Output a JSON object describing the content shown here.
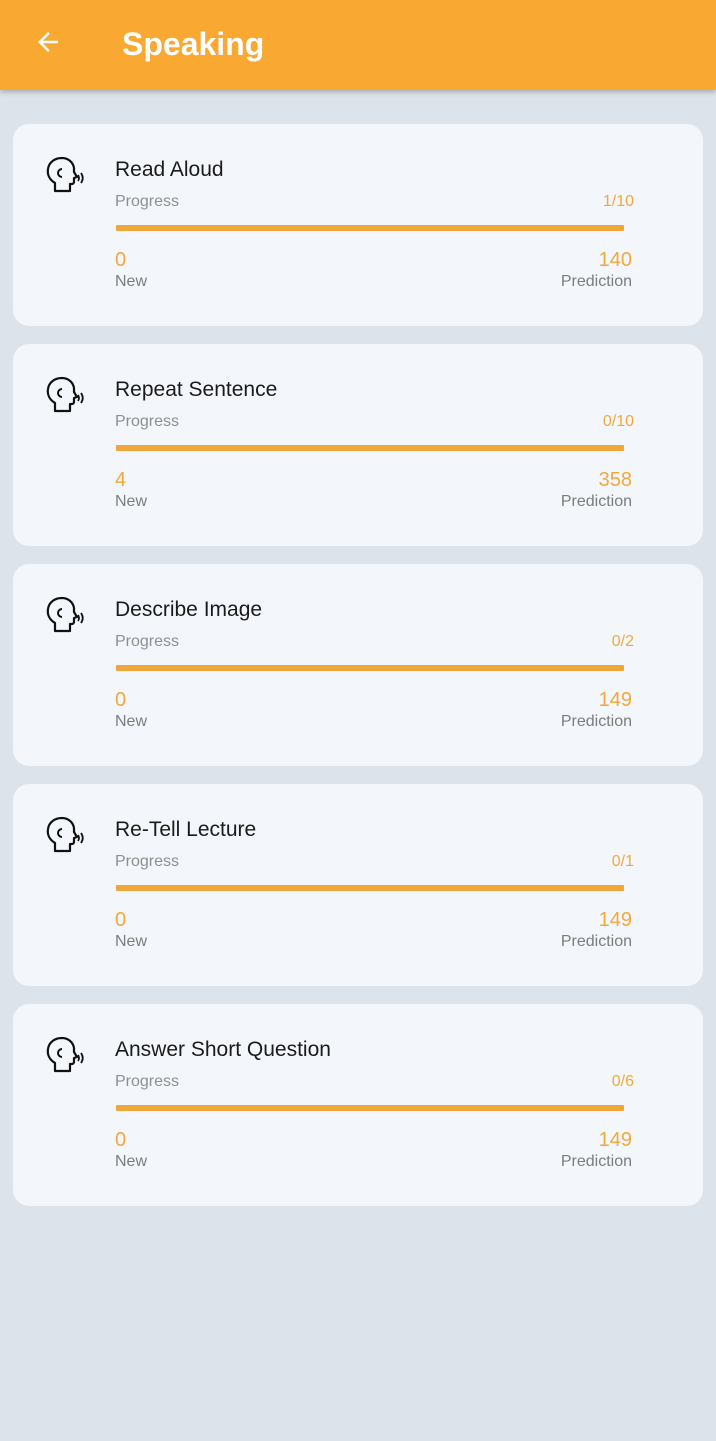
{
  "header": {
    "title": "Speaking",
    "back_icon": "arrow-left-icon",
    "background_color": "#f9a932"
  },
  "cards": [
    {
      "title": "Read Aloud",
      "icon": "speaking-head-icon",
      "progress_label": "Progress",
      "progress_text": "1/10",
      "progress_fraction": 1.0,
      "new_count": "0",
      "new_label": "New",
      "prediction_count": "140",
      "prediction_label": "Prediction"
    },
    {
      "title": "Repeat Sentence",
      "icon": "speaking-head-icon",
      "progress_label": "Progress",
      "progress_text": "0/10",
      "progress_fraction": 1.0,
      "new_count": "4",
      "new_label": "New",
      "prediction_count": "358",
      "prediction_label": "Prediction"
    },
    {
      "title": "Describe Image",
      "icon": "speaking-head-icon",
      "progress_label": "Progress",
      "progress_text": "0/2",
      "progress_fraction": 1.0,
      "new_count": "0",
      "new_label": "New",
      "prediction_count": "149",
      "prediction_label": "Prediction"
    },
    {
      "title": "Re-Tell Lecture",
      "icon": "speaking-head-icon",
      "progress_label": "Progress",
      "progress_text": "0/1",
      "progress_fraction": 1.0,
      "new_count": "0",
      "new_label": "New",
      "prediction_count": "149",
      "prediction_label": "Prediction"
    },
    {
      "title": "Answer Short Question",
      "icon": "speaking-head-icon",
      "progress_label": "Progress",
      "progress_text": "0/6",
      "progress_fraction": 1.0,
      "new_count": "0",
      "new_label": "New",
      "prediction_count": "149",
      "prediction_label": "Prediction"
    }
  ],
  "colors": {
    "accent": "#f2a93b",
    "card_background": "#f3f6fa",
    "page_background": "#dde3ea"
  }
}
